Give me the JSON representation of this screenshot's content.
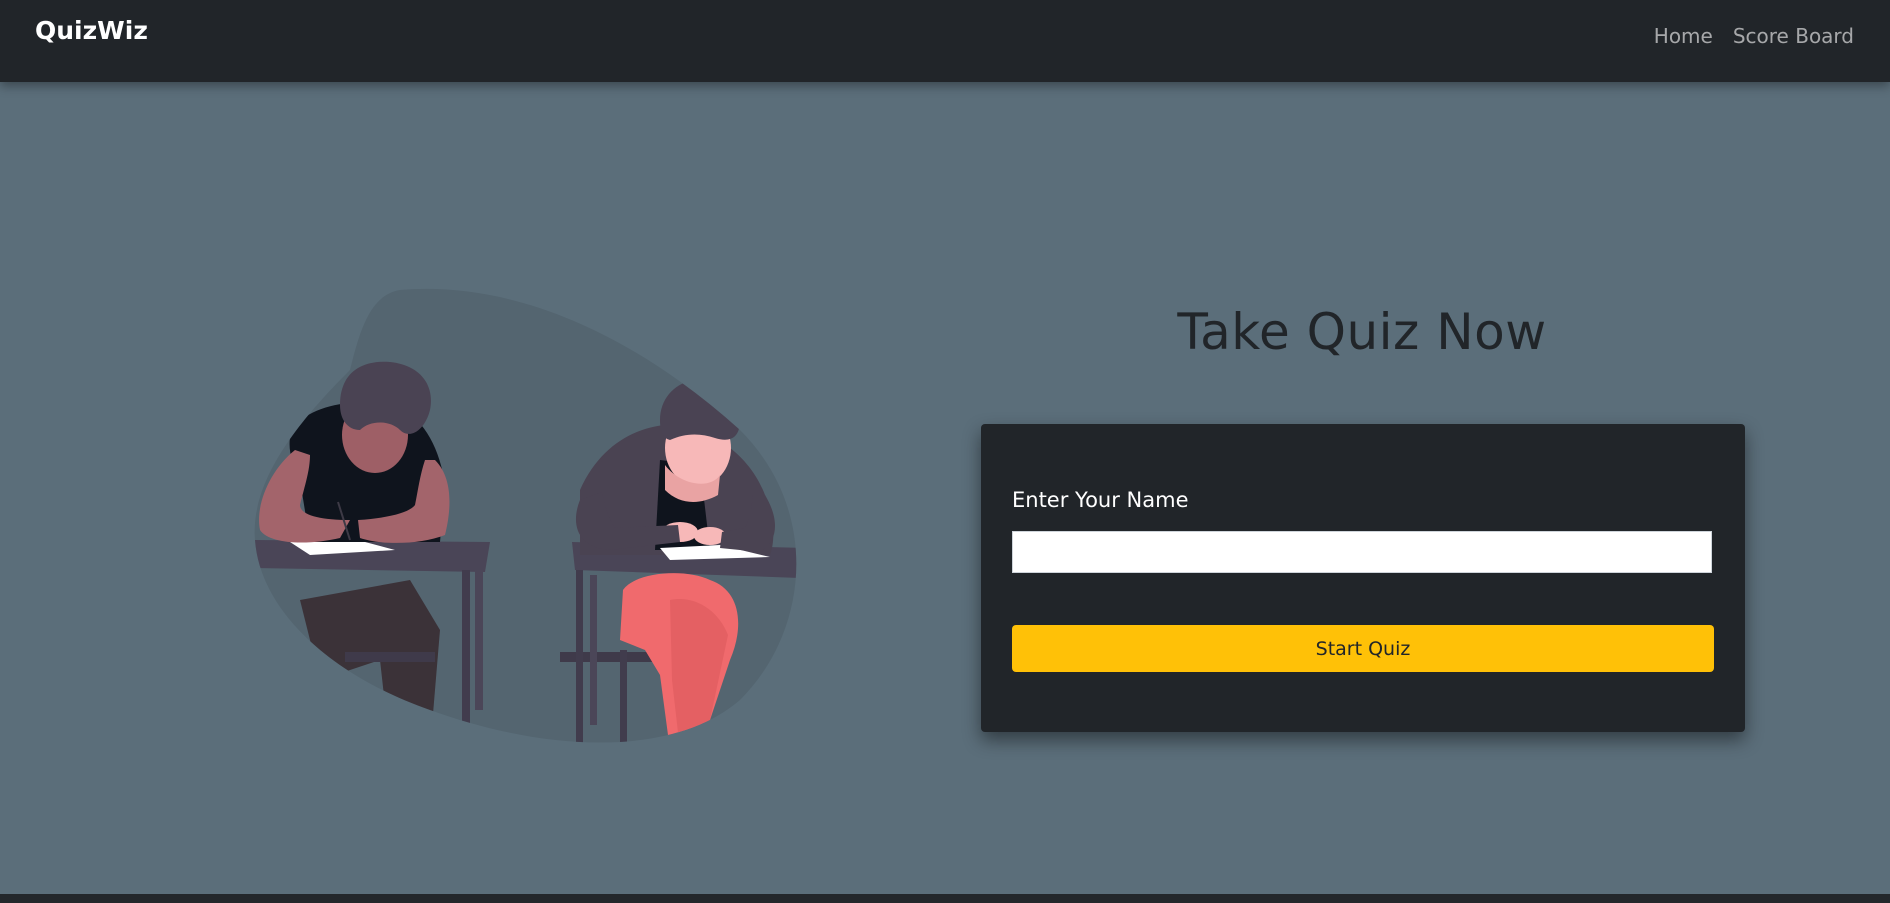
{
  "navbar": {
    "brand": "QuizWiz",
    "links": [
      {
        "label": "Home"
      },
      {
        "label": "Score Board"
      }
    ]
  },
  "hero": {
    "title": "Take Quiz Now"
  },
  "form": {
    "name_label": "Enter Your Name",
    "name_value": "",
    "name_placeholder": "",
    "start_button": "Start Quiz"
  },
  "colors": {
    "background": "#5b6e7a",
    "navbar": "#212529",
    "card": "#212529",
    "accent_button": "#ffc107"
  },
  "illustration": {
    "icon": "students-taking-exam-illustration"
  }
}
